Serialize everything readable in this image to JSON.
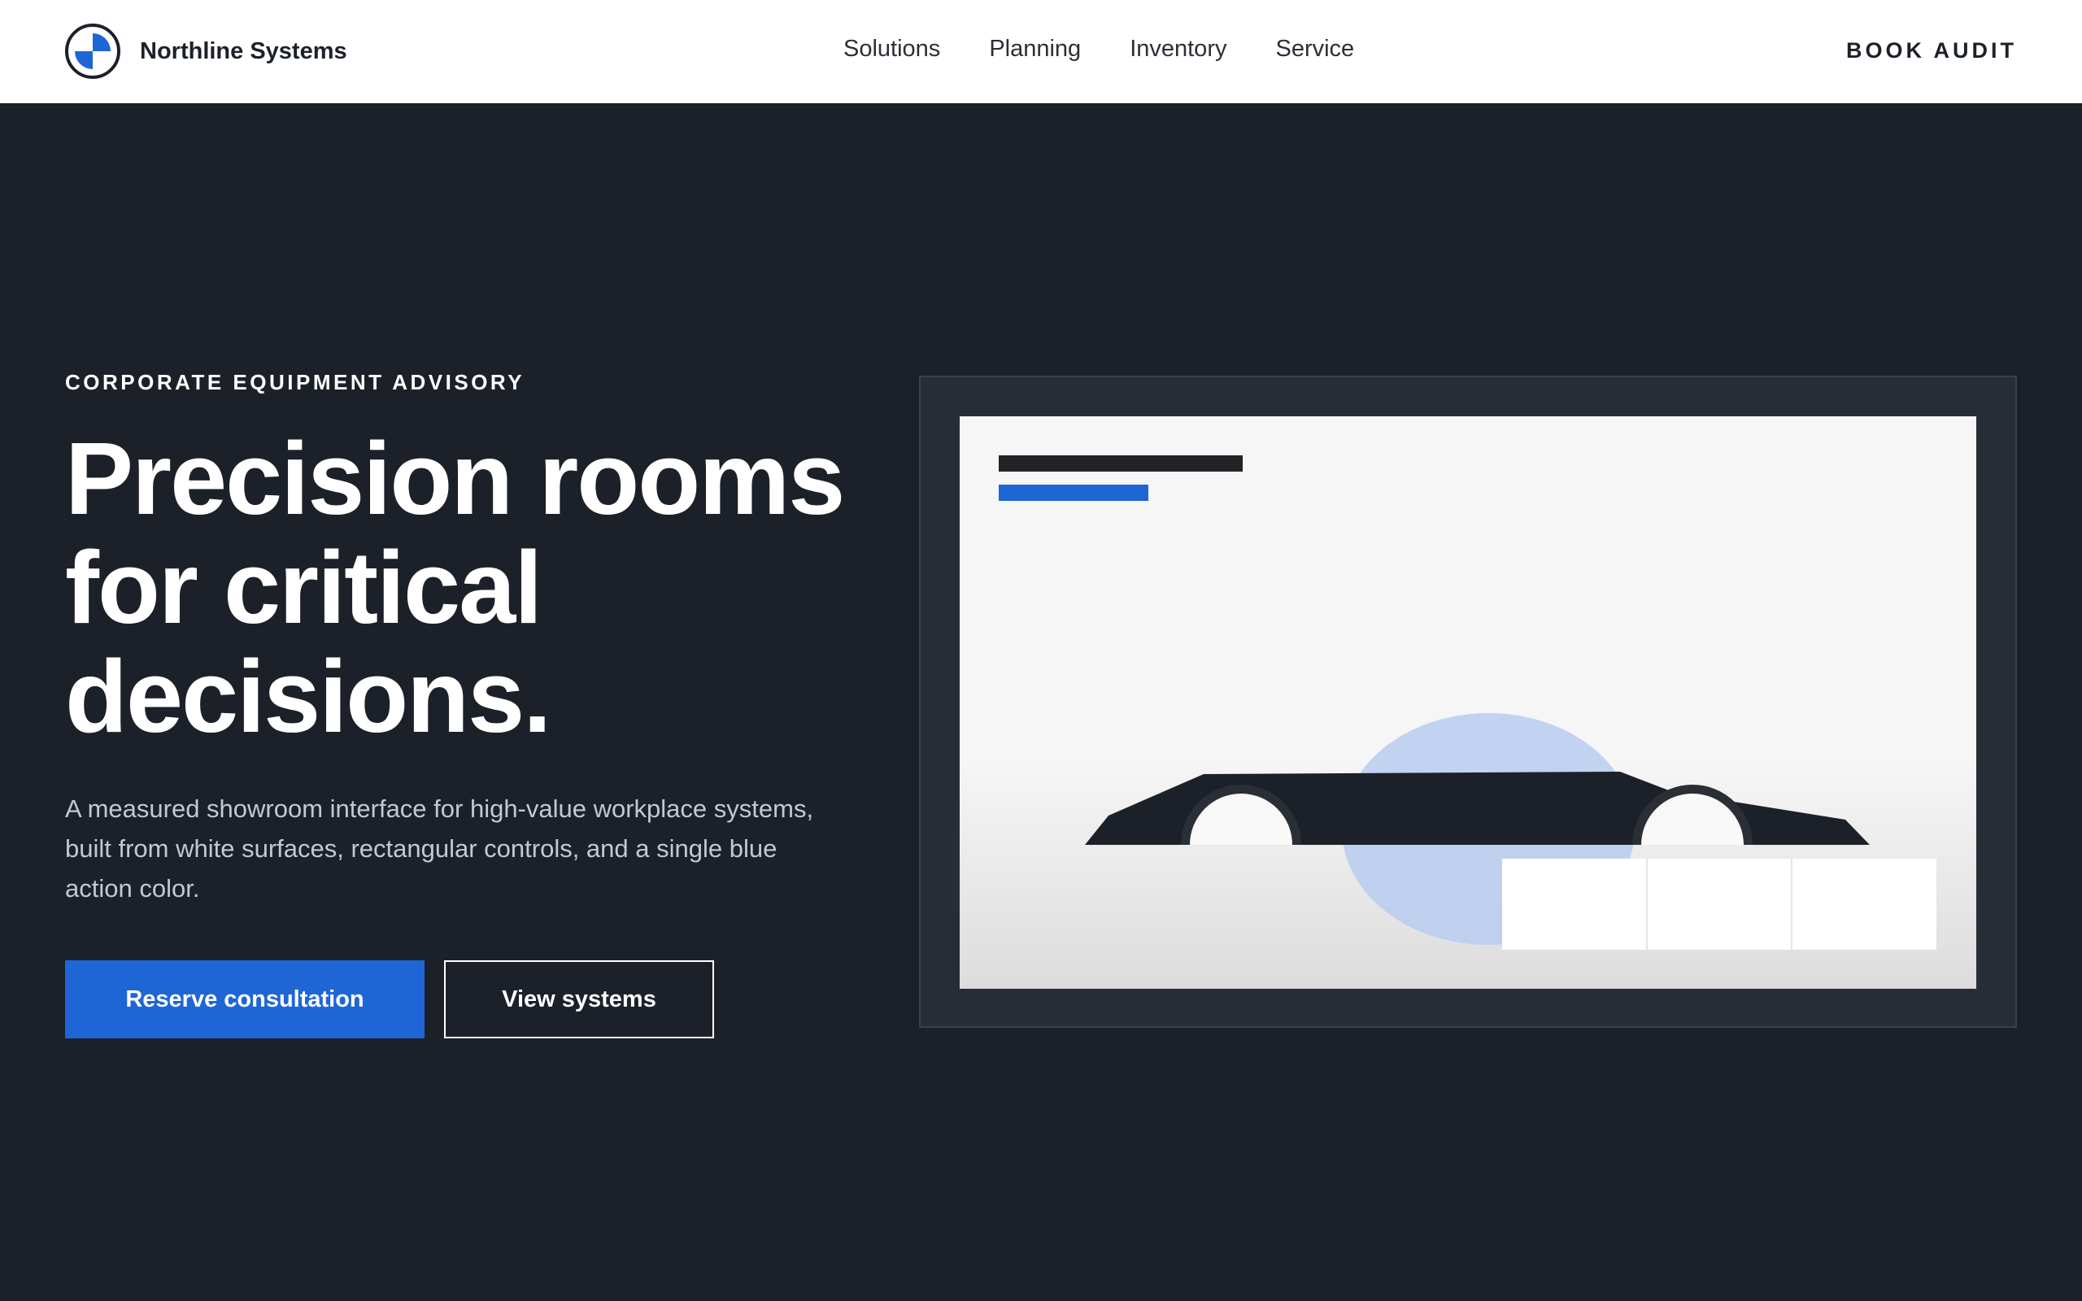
{
  "header": {
    "brand_name": "Northline Systems",
    "logo_icon": "quartered-circle-logo",
    "nav": [
      "Solutions",
      "Planning",
      "Inventory",
      "Service"
    ],
    "cta": "BOOK AUDIT"
  },
  "hero": {
    "eyebrow": "CORPORATE EQUIPMENT ADVISORY",
    "headline": "Precision rooms\nfor critical\ndecisions.",
    "lede": "A measured showroom interface for high-value workplace systems, built from white surfaces, rectangular controls, and a single blue action color.",
    "primary_button": "Reserve consultation",
    "secondary_button": "View systems"
  },
  "colors": {
    "background": "#1c2129",
    "accent": "#1e66d6",
    "panel": "#272d37",
    "surface": "#f6f6f6"
  }
}
